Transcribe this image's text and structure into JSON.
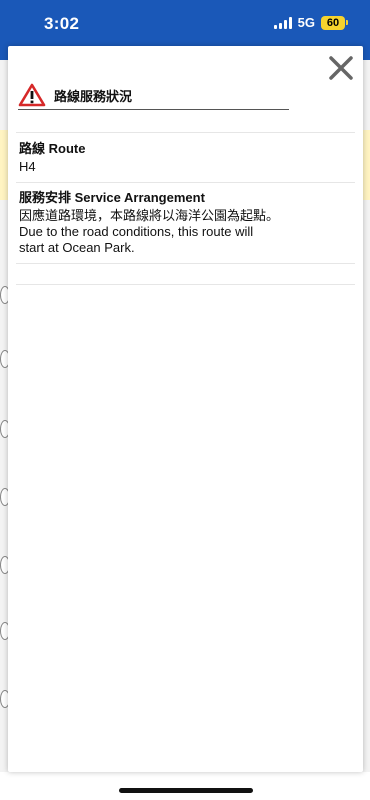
{
  "status_bar": {
    "time": "3:02",
    "network": "5G",
    "battery": "60"
  },
  "modal": {
    "title": "路線服務狀況",
    "route_label": "路線 Route",
    "route_value": "H4",
    "arrangement_label": "服務安排 Service Arrangement",
    "arrangement_line1": "因應道路環境，本路線將以海洋公園為起點。",
    "arrangement_line2": "Due to the road conditions, this route will",
    "arrangement_line3": "start at Ocean Park."
  },
  "icons": {
    "warning": "warning-triangle-icon",
    "close": "close-icon"
  },
  "colors": {
    "header_blue": "#1a58b8",
    "warning_red": "#d62828",
    "battery_yellow": "#f6d32d"
  }
}
